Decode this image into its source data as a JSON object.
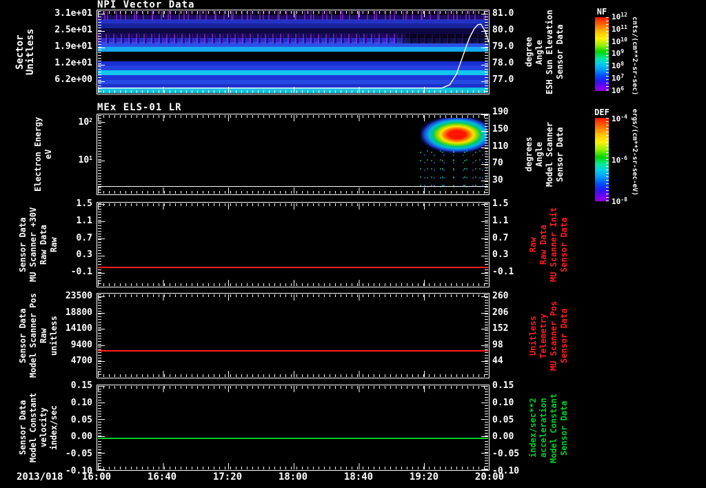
{
  "x_axis": {
    "date": "2013/018",
    "ticks": [
      "16:00",
      "16:40",
      "17:20",
      "18:00",
      "18:40",
      "19:20",
      "20:00"
    ]
  },
  "panels": [
    {
      "id": "npi",
      "title": "NPI Vector Data",
      "left_label": [
        "Sector",
        "Unitless"
      ],
      "left_ticks": [
        "3.1e+01",
        "2.5e+01",
        "1.9e+01",
        "1.2e+01",
        "6.2e+00"
      ],
      "right_ticks": [
        "81.0",
        "80.0",
        "79.0",
        "78.0",
        "77.0"
      ],
      "right_label": [
        "Sensor Data",
        "ESH Sun Elevation",
        "Angle",
        "degree"
      ],
      "colorbar": {
        "name": "NF",
        "unit": "cnts/(cm**2-sr-sec)",
        "ticks": [
          {
            "base": "10",
            "exp": "12"
          },
          {
            "base": "10",
            "exp": "11"
          },
          {
            "base": "10",
            "exp": "10"
          },
          {
            "base": "10",
            "exp": "9"
          },
          {
            "base": "10",
            "exp": "8"
          },
          {
            "base": "10",
            "exp": "7"
          },
          {
            "base": "10",
            "exp": "6"
          }
        ]
      }
    },
    {
      "id": "els",
      "title": "MEx ELS-01 LR",
      "left_label": [
        "Electron Energy",
        "eV"
      ],
      "left_ticks": [
        {
          "base": "10",
          "exp": "2"
        },
        {
          "base": "10",
          "exp": "1"
        }
      ],
      "right_ticks": [
        "190",
        "150",
        "110",
        "70",
        "30"
      ],
      "right_label": [
        "Sensor Data",
        "Model Scanner",
        "Angle",
        "degrees"
      ],
      "colorbar": {
        "name": "DEF",
        "unit": "ergs/(cm**2-sr-sec-eV)",
        "ticks": [
          {
            "base": "10",
            "exp": "-4"
          },
          {
            "base": "10",
            "exp": "-6"
          },
          {
            "base": "10",
            "exp": "-8"
          }
        ]
      }
    },
    {
      "id": "mu-scanner-30v",
      "left_label": [
        "Sensor Data",
        "MU Scanner +30V",
        "Raw Data",
        "Raw"
      ],
      "left_ticks": [
        "1.5",
        "1.1",
        "0.7",
        "0.3",
        "-0.1"
      ],
      "right_ticks": [
        "1.5",
        "1.1",
        "0.7",
        "0.3",
        "-0.1"
      ],
      "right_label": [
        "Sensor Data",
        "MU Scanner Init",
        "Raw Data",
        "Raw"
      ],
      "line_color": "#ff1e1e"
    },
    {
      "id": "model-scanner-pos",
      "left_label": [
        "Sensor Data",
        "Model Scanner Pos",
        "Raw",
        "unitless"
      ],
      "left_ticks": [
        "23500",
        "18800",
        "14100",
        "9400",
        "4700"
      ],
      "right_ticks": [
        "260",
        "206",
        "152",
        "98",
        "44"
      ],
      "right_label": [
        "Sensor Data",
        "MU Scanner Pos",
        "Telemetry",
        "Unitless"
      ],
      "line_color": "#ff1e1e"
    },
    {
      "id": "model-constant-velocity",
      "left_label": [
        "Sensor Data",
        "Model Constant",
        "velocity",
        "index/sec"
      ],
      "left_ticks": [
        "0.15",
        "0.10",
        "0.05",
        "0.00",
        "-0.05",
        "-0.10"
      ],
      "right_ticks": [
        "0.15",
        "0.10",
        "0.05",
        "0.00",
        "-0.05",
        "-0.10"
      ],
      "right_label": [
        "Sensor Data",
        "Model Constant",
        "acceleration",
        "index/sec**2"
      ],
      "line_color": "#00d028"
    }
  ],
  "colors": {
    "frame": "#ffffff",
    "red_series": "#ff1e1e",
    "green_series": "#00d028",
    "background": "#000000"
  },
  "visual": {
    "npi_stripes": [
      {
        "w": 6,
        "c": "#07000f"
      },
      {
        "w": 6,
        "c": "#1e0d5e"
      },
      {
        "w": 7,
        "c": "#2232c4"
      },
      {
        "w": 7,
        "c": "#18249e"
      },
      {
        "w": 7,
        "c": "#0d0742"
      },
      {
        "w": 7,
        "c": "#110a50"
      },
      {
        "w": 7,
        "c": "#1d31ce"
      },
      {
        "w": 7,
        "c": "#2b4fe8"
      },
      {
        "w": 7,
        "c": "#17aaf2"
      },
      {
        "w": 14,
        "c": "#010103"
      },
      {
        "w": 7,
        "c": "#1a2ed2"
      },
      {
        "w": 7,
        "c": "#2443e0"
      },
      {
        "w": 7,
        "c": "#13c6ee"
      },
      {
        "w": 7,
        "c": "#1e36d8"
      },
      {
        "w": 7,
        "c": "#2547e2"
      },
      {
        "w": 5,
        "c": "#1c30c8"
      },
      {
        "w": 8,
        "c": "#12c2de"
      }
    ]
  },
  "chart_data": [
    {
      "type": "heatmap",
      "title": "NPI Vector Data",
      "xlabel_start": "2013/018 16:00",
      "xlabel_end": "2013/018 20:00",
      "x_ticks": [
        "16:00",
        "16:40",
        "17:20",
        "18:00",
        "18:40",
        "19:20",
        "20:00"
      ],
      "ylabel": "Sector (Unitless)",
      "yticks": [
        31,
        25,
        19,
        12,
        6.2
      ],
      "colorbar": {
        "name": "NF",
        "unit": "cnts/(cm**2-sr-sec)",
        "scale": "log",
        "tick_exponents": [
          12,
          11,
          10,
          9,
          8,
          7,
          6
        ]
      },
      "description": "Horizontally banded blue/cyan count-rate spectrogram; bright cyan bands near sectors ~19, ~10 and ~2; black band near sectors 13-16; purple speckle noise in top sectors until ~19:20",
      "overlay_series": {
        "name": "ESH Sun Elevation Angle (degree)",
        "axis": "right",
        "right_ticks": [
          81.0,
          80.0,
          79.0,
          78.0,
          77.0
        ],
        "points": [
          [
            0,
            76.55
          ],
          [
            0.88,
            76.55
          ],
          [
            0.9,
            76.75
          ],
          [
            0.917,
            77.4
          ],
          [
            0.935,
            78.6
          ],
          [
            0.95,
            79.6
          ],
          [
            0.962,
            80.15
          ],
          [
            0.972,
            80.42
          ],
          [
            0.98,
            80.45
          ],
          [
            0.99,
            80.05
          ],
          [
            1,
            79.35
          ]
        ]
      }
    },
    {
      "type": "heatmap",
      "title": "MEx ELS-01 LR",
      "ylabel": "Electron Energy (eV)",
      "yscale": "log",
      "yticks": [
        100,
        10
      ],
      "right_axis": {
        "label": "Sensor Data Model Scanner Angle (degrees)",
        "ticks": [
          190,
          150,
          110,
          70,
          30
        ]
      },
      "colorbar": {
        "name": "DEF",
        "unit": "ergs/(cm**2-sr-sec-eV)",
        "scale": "log",
        "tick_exponents": [
          -4,
          -6,
          -8
        ]
      },
      "description": "Empty (black) until ~19:15, then intense electron flux burst 19:15-20:00: red/orange core near 40-150 eV with green/cyan halo and scattered blue-green flux down to a few eV; thin white horizontal line near panel bottom across full width"
    },
    {
      "type": "line",
      "name": "Sensor Data MU Scanner +30V Raw Data Raw",
      "color": "#ff1e1e",
      "yticks": [
        1.5,
        1.1,
        0.7,
        0.3,
        -0.1
      ],
      "series": [
        {
          "name": "MU Scanner +30V",
          "constant_value": 0.0
        }
      ]
    },
    {
      "type": "line",
      "name": "Sensor Data Model Scanner Pos Raw unitless",
      "color": "#ff1e1e",
      "yticks_left": [
        23500,
        18800,
        14100,
        9400,
        4700
      ],
      "yticks_right": [
        260,
        206,
        152,
        98,
        44
      ],
      "series": [
        {
          "name": "Model Scanner Pos",
          "constant_value_left_scale": 8200,
          "constant_value_right_scale": 86
        }
      ]
    },
    {
      "type": "line",
      "name": "Sensor Data Model Constant velocity index/sec",
      "color": "#00d028",
      "yticks": [
        0.15,
        0.1,
        0.05,
        0.0,
        -0.05,
        -0.1
      ],
      "series": [
        {
          "name": "Model Constant velocity",
          "constant_value": 0.0
        }
      ]
    }
  ]
}
